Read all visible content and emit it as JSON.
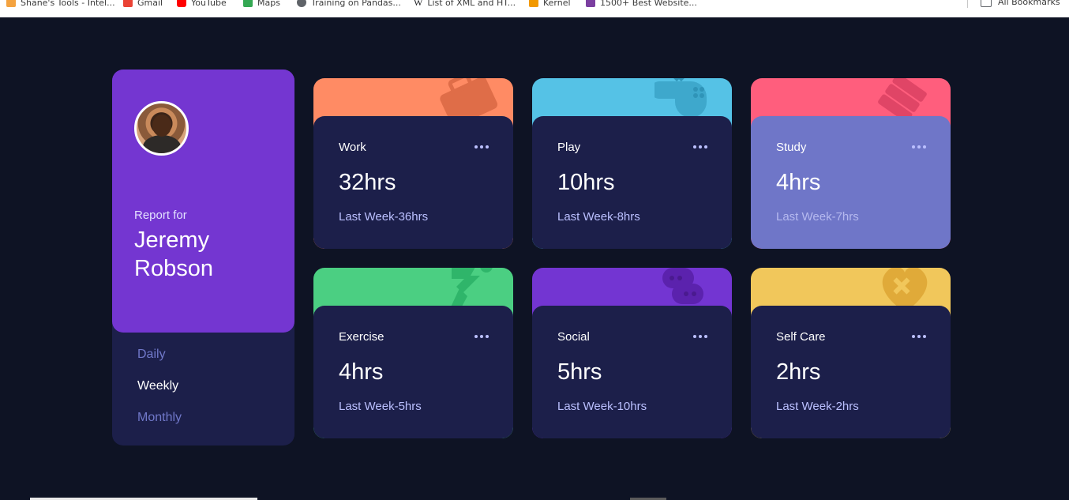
{
  "bookmarks": {
    "items": [
      {
        "label": "Shane's Tools - Intel...",
        "color": "#f4a340"
      },
      {
        "label": "Gmail",
        "color": "#ea4335"
      },
      {
        "label": "YouTube",
        "color": "#ff0000"
      },
      {
        "label": "Maps",
        "color": "#34a853"
      },
      {
        "label": "Training on Pandas...",
        "color": "#5f6368"
      },
      {
        "label": "List of XML and HT...",
        "color": "#202124"
      },
      {
        "label": "Kernel",
        "color": "#f29900"
      },
      {
        "label": "1500+ Best Website...",
        "color": "#7b3fa0"
      }
    ],
    "all_label": "All Bookmarks"
  },
  "profile": {
    "report_for": "Report for",
    "name": "Jeremy Robson",
    "periods": [
      "Daily",
      "Weekly",
      "Monthly"
    ],
    "active_period": "Weekly"
  },
  "activities": [
    {
      "title": "Work",
      "hours": "32hrs",
      "previous": "Last Week-36hrs",
      "color": "#ff8b64",
      "icon": "briefcase-icon"
    },
    {
      "title": "Play",
      "hours": "10hrs",
      "previous": "Last Week-8hrs",
      "color": "#55c2e6",
      "icon": "gamepad-icon"
    },
    {
      "title": "Study",
      "hours": "4hrs",
      "previous": "Last Week-7hrs",
      "color": "#ff5e7d",
      "icon": "books-icon"
    },
    {
      "title": "Exercise",
      "hours": "4hrs",
      "previous": "Last Week-5hrs",
      "color": "#4bcf82",
      "icon": "runner-icon"
    },
    {
      "title": "Social",
      "hours": "5hrs",
      "previous": "Last Week-10hrs",
      "color": "#7335d2",
      "icon": "social-icon"
    },
    {
      "title": "Self Care",
      "hours": "2hrs",
      "previous": "Last Week-2hrs",
      "color": "#f1c75b",
      "icon": "heart-bandage-icon"
    }
  ]
}
